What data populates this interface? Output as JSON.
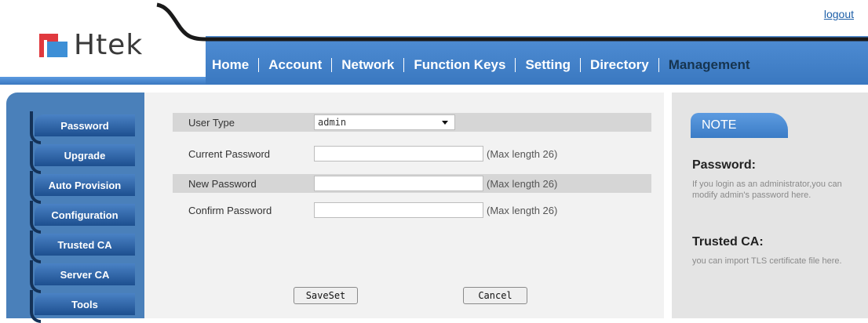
{
  "header": {
    "logout": "logout",
    "logo_text": "Htek",
    "nav": [
      {
        "label": "Home"
      },
      {
        "label": "Account"
      },
      {
        "label": "Network"
      },
      {
        "label": "Function Keys"
      },
      {
        "label": "Setting"
      },
      {
        "label": "Directory"
      },
      {
        "label": "Management"
      }
    ],
    "active_nav": "Management"
  },
  "sidebar": {
    "items": [
      {
        "label": "Password"
      },
      {
        "label": "Upgrade"
      },
      {
        "label": "Auto Provision"
      },
      {
        "label": "Configuration"
      },
      {
        "label": "Trusted CA"
      },
      {
        "label": "Server CA"
      },
      {
        "label": "Tools"
      }
    ]
  },
  "form": {
    "user_type_label": "User Type",
    "user_type_value": "admin",
    "current_password_label": "Current Password",
    "current_password_value": "",
    "current_password_hint": "(Max length 26)",
    "new_password_label": "New Password",
    "new_password_value": "",
    "new_password_hint": "(Max length 26)",
    "confirm_password_label": "Confirm Password",
    "confirm_password_value": "",
    "confirm_password_hint": "(Max length 26)",
    "saveset_label": "SaveSet",
    "cancel_label": "Cancel"
  },
  "note": {
    "tab": "NOTE",
    "sections": [
      {
        "title": "Password:",
        "text": "If you login as an administrator,you can modify admin's password here."
      },
      {
        "title": "Trusted CA:",
        "text": "you can import TLS certificate file here."
      }
    ]
  },
  "colors": {
    "nav_bar": "#4a88cd",
    "sidebar": "#4a80ba",
    "active_nav": "#16344f",
    "logo_red": "#e0393e",
    "logo_blue": "#3d8fd6"
  }
}
